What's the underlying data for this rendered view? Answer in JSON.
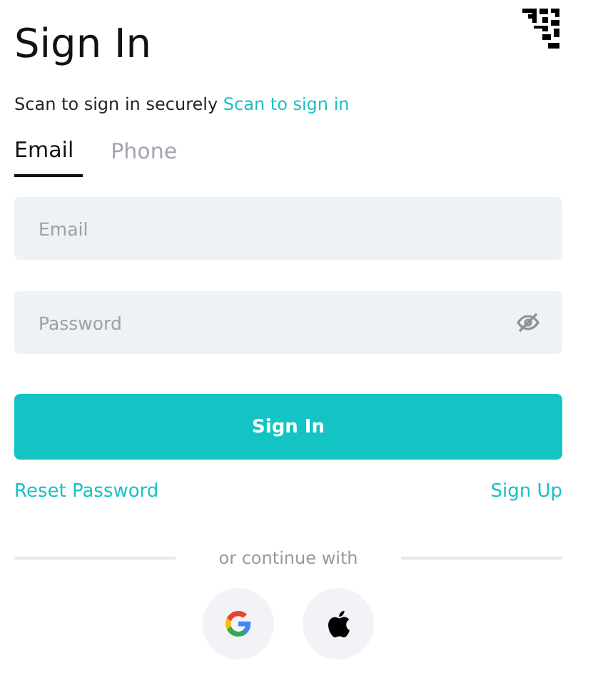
{
  "title": "Sign In",
  "subtitle": {
    "text": "Scan to sign in securely",
    "link": "Scan to sign in"
  },
  "tabs": [
    {
      "label": "Email",
      "selected": true
    },
    {
      "label": "Phone",
      "selected": false
    }
  ],
  "fields": [
    {
      "kind": "email",
      "placeholder": "Email"
    },
    {
      "kind": "password",
      "placeholder": "Password"
    }
  ],
  "submit": "Sign In",
  "links": {
    "reset": "Reset Password",
    "signup": "Sign Up"
  },
  "divider": "or continue with",
  "social": [
    {
      "kind": "google"
    },
    {
      "kind": "apple"
    }
  ]
}
